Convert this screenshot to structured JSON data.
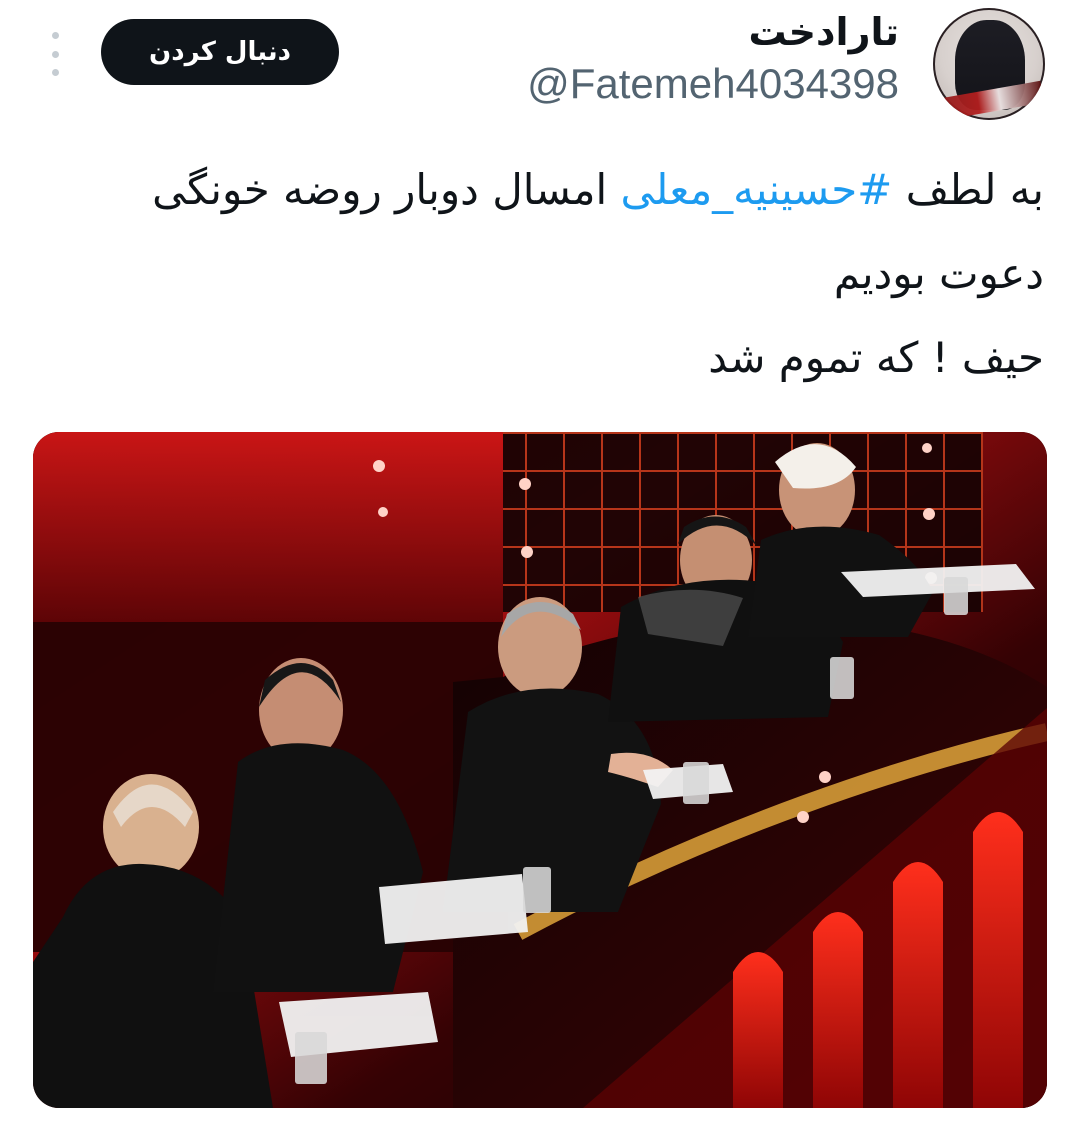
{
  "header": {
    "display_name": "تارادخت",
    "handle": "@Fatemeh4034398",
    "follow_label": "دنبال کردن"
  },
  "tweet": {
    "text_before": "به لطف ",
    "hashtag": "#حسینیه_معلی",
    "text_after_line1": " امسال دوبار روضه خونگی",
    "line2": "دعوت بودیم",
    "line3": "حیف ! که تموم شد"
  },
  "icons": {
    "avatar": "profile-avatar",
    "more": "more-vertical-icon"
  },
  "colors": {
    "accent": "#1d9bf0",
    "button": "#0f1419",
    "muted": "#536471"
  }
}
